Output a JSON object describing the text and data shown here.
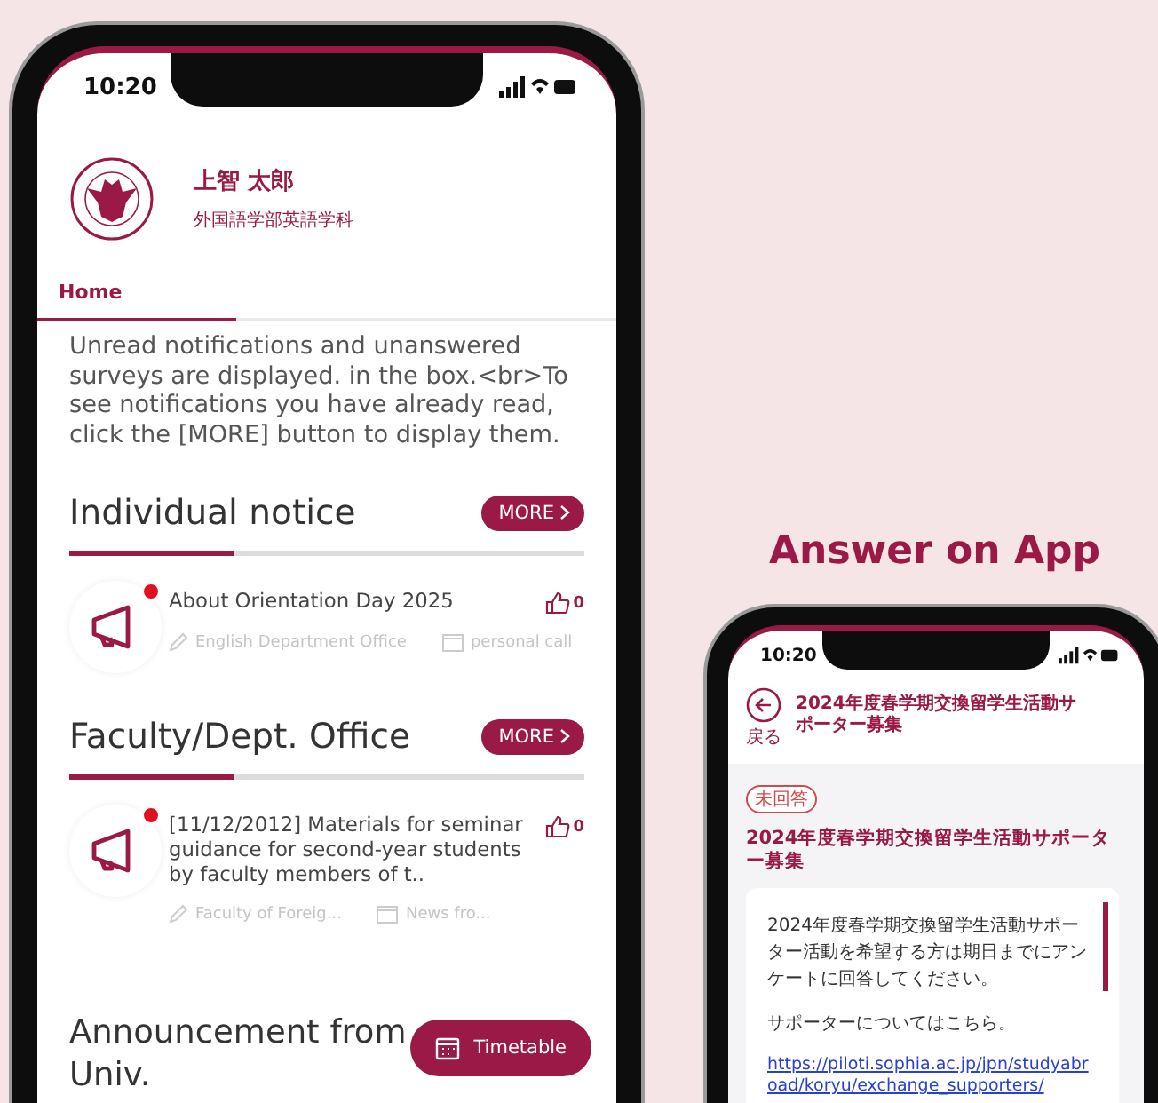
{
  "left_phone": {
    "status_bar": {
      "time": "10:20"
    },
    "profile": {
      "name": "上智 太郎",
      "department": "外国語学部英語学科"
    },
    "tabs": [
      {
        "label": "Home",
        "selected": true
      }
    ],
    "intro": "Unread notifications and unanswered surveys are displayed. in the box.<br>To see notifications you have already read, click the [MORE] button to display them.",
    "sections": [
      {
        "title": "Individual notice",
        "button": "MORE",
        "items": [
          {
            "title": "About Orientation Day 2025",
            "unread": true,
            "likes": "0",
            "sender": "English Department Office",
            "category": "personal call"
          }
        ]
      },
      {
        "title": "Faculty/Dept. Office",
        "button": "MORE",
        "items": [
          {
            "title": "[11/12/2012] Materials for seminar guidance for second-year students by faculty members of t..",
            "unread": true,
            "likes": "0",
            "sender": "Faculty of Foreig...",
            "category": "News fro..."
          }
        ]
      }
    ],
    "announcement": {
      "title": "Announcement from Univ.",
      "button": "Timetable"
    }
  },
  "headline": "Answer on App",
  "right_phone": {
    "status_bar": {
      "time": "10:20"
    },
    "back_label": "戻る",
    "title": "2024年度春学期交換留学生活動サポーター募集",
    "status_badge": "未回答",
    "heading": "2024年度春学期交換留学生活動サポーター募集",
    "body": [
      "2024年度春学期交換留学生活動サポーター活動を希望する方は期日までにアンケートに回答してください。",
      "サポーターについてはこちら。"
    ],
    "link": "https://piloti.sophia.ac.jp/jpn/studyabroad/koryu/exchange_supporters/"
  }
}
